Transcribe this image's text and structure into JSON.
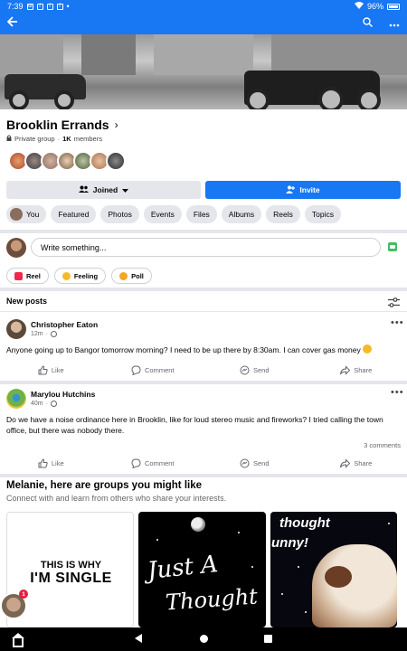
{
  "status_bar": {
    "time": "7:39",
    "battery": "96%"
  },
  "app_bar": {
    "back_icon": "arrow-left-icon",
    "search_icon": "search-icon",
    "more_icon": "more-icon"
  },
  "group": {
    "name": "Brooklin Errands",
    "privacy": "Private group",
    "separator": "·",
    "member_count": "1K",
    "member_label": "members"
  },
  "buttons": {
    "joined": "Joined",
    "invite": "Invite"
  },
  "tabs": [
    "You",
    "Featured",
    "Photos",
    "Events",
    "Files",
    "Albums",
    "Reels",
    "Topics"
  ],
  "composer": {
    "placeholder": "Write something..."
  },
  "chips": [
    {
      "label": "Reel",
      "color": "#f02849"
    },
    {
      "label": "Feeling",
      "color": "#f7b928"
    },
    {
      "label": "Poll",
      "color": "#f5a623"
    }
  ],
  "feed": {
    "heading": "New posts",
    "posts": [
      {
        "author": "Christopher Eaton",
        "time": "12m",
        "text": "Anyone going up to Bangor tomorrow morning? I need to be up there by 8:30am. I can cover gas money",
        "comments": ""
      },
      {
        "author": "Marylou Hutchins",
        "time": "40m",
        "text": "Do we have a noise ordinance here in Brooklin, like for loud stereo music and fireworks? I tried calling the town office, but there was nobody there.",
        "comments": "3 comments"
      }
    ],
    "actions": [
      "Like",
      "Comment",
      "Send",
      "Share"
    ]
  },
  "suggestions": {
    "title": "Melanie, here are groups you might like",
    "subtitle": "Connect with and learn from others who share your interests.",
    "cards": [
      {
        "line1": "THIS IS WHY",
        "line2": "I'M SINGLE"
      },
      {
        "line1": "Just A",
        "line2": "Thought"
      },
      {
        "line1": "thought",
        "line2": "unny!"
      }
    ]
  },
  "chat_head": {
    "badge": "1"
  },
  "colors": {
    "brand": "#1877f2",
    "button_gray": "#e4e6eb",
    "text_secondary": "#65676b"
  }
}
